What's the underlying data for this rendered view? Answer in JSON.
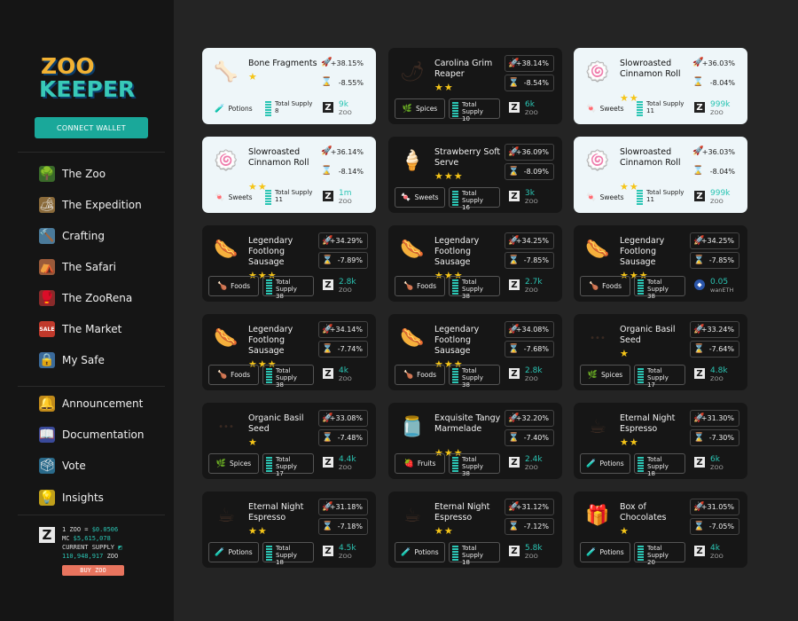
{
  "logo": {
    "line1": "ZOO",
    "line2": "KEEPER"
  },
  "connect_label": "CONNECT WALLET",
  "nav": [
    {
      "label": "The Zoo",
      "icon": "zoo-icon",
      "emoji": "🌳",
      "bg": "#3a6a2a"
    },
    {
      "label": "The Expedition",
      "icon": "expedition-icon",
      "emoji": "🏕",
      "bg": "#8a6a3a"
    },
    {
      "label": "Crafting",
      "icon": "crafting-icon",
      "emoji": "🔨",
      "bg": "#4a7a9a"
    },
    {
      "label": "The Safari",
      "icon": "safari-icon",
      "emoji": "⛺",
      "bg": "#9a5a3a"
    },
    {
      "label": "The ZooRena",
      "icon": "zoorena-icon",
      "emoji": "🥊",
      "bg": "#8a2a2a"
    },
    {
      "label": "The Market",
      "icon": "market-icon",
      "emoji": "SALE",
      "bg": "#c0392b"
    },
    {
      "label": "My Safe",
      "icon": "safe-icon",
      "emoji": "🔒",
      "bg": "#3a6a9a"
    },
    {
      "label": "Announcement",
      "icon": "bell-icon",
      "emoji": "🔔",
      "bg": "#c08a1a"
    },
    {
      "label": "Documentation",
      "icon": "book-icon",
      "emoji": "📖",
      "bg": "#3a4a9a"
    },
    {
      "label": "Vote",
      "icon": "vote-icon",
      "emoji": "🗳",
      "bg": "#2a6a8a"
    },
    {
      "label": "Insights",
      "icon": "insights-icon",
      "emoji": "💡",
      "bg": "#c0a01a"
    }
  ],
  "zinfo": {
    "l1a": "1 ZOO = ",
    "l1b": "$0.0506",
    "l2a": "MC ",
    "l2b": "$5,615,078",
    "l3": "CURRENT SUPPLY",
    "l4a": "110,948,917",
    "l4b": " ZOO",
    "buy": "BUY ZOO"
  },
  "cards": [
    {
      "name": "Bone Fragments",
      "stars": "★",
      "up": "+38.15%",
      "down": "-8.55%",
      "cat": "Potions",
      "catIcon": "potion-icon",
      "catGlyph": "🧪",
      "supply_label": "Total Supply",
      "supply": "8",
      "price": "9k",
      "unit": "ZOO",
      "img": "bone-icon",
      "glyph": "🦴",
      "light": true
    },
    {
      "name": "Carolina Grim Reaper",
      "stars": "★★",
      "up": "+38.14%",
      "down": "-8.54%",
      "cat": "Spices",
      "catIcon": "spice-icon",
      "catGlyph": "🌿",
      "supply_label": "Total Supply",
      "supply": "10",
      "price": "6k",
      "unit": "ZOO",
      "img": "pepper-icon",
      "glyph": "🌶",
      "light": false
    },
    {
      "name": "Slowroasted Cinnamon Roll",
      "stars": "★★",
      "up": "+36.03%",
      "down": "-8.04%",
      "cat": "Sweets",
      "catIcon": "candy-icon",
      "catGlyph": "🍬",
      "supply_label": "Total Supply",
      "supply": "11",
      "price": "999k",
      "unit": "ZOO",
      "img": "cinnamon-roll-icon",
      "glyph": "🍥",
      "light": true
    },
    {
      "name": "Slowroasted Cinnamon Roll",
      "stars": "★★",
      "up": "+36.14%",
      "down": "-8.14%",
      "cat": "Sweets",
      "catIcon": "candy-icon",
      "catGlyph": "🍬",
      "supply_label": "Total Supply",
      "supply": "11",
      "price": "1m",
      "unit": "ZOO",
      "img": "cinnamon-roll-icon",
      "glyph": "🍥",
      "light": true
    },
    {
      "name": "Strawberry Soft Serve",
      "stars": "★★★",
      "up": "+36.09%",
      "down": "-8.09%",
      "cat": "Sweets",
      "catIcon": "candy-icon",
      "catGlyph": "🍬",
      "supply_label": "Total Supply",
      "supply": "16",
      "price": "3k",
      "unit": "ZOO",
      "img": "ice-cream-icon",
      "glyph": "🍦",
      "light": false
    },
    {
      "name": "Slowroasted Cinnamon Roll",
      "stars": "★★",
      "up": "+36.03%",
      "down": "-8.04%",
      "cat": "Sweets",
      "catIcon": "candy-icon",
      "catGlyph": "🍬",
      "supply_label": "Total Supply",
      "supply": "11",
      "price": "999k",
      "unit": "ZOO",
      "img": "cinnamon-roll-icon",
      "glyph": "🍥",
      "light": true
    },
    {
      "name": "Legendary Footlong Sausage",
      "stars": "★★★",
      "up": "+34.29%",
      "down": "-7.89%",
      "cat": "Foods",
      "catIcon": "food-icon",
      "catGlyph": "🍗",
      "supply_label": "Total Supply",
      "supply": "38",
      "price": "2.8k",
      "unit": "ZOO",
      "img": "sausage-icon",
      "glyph": "🌭",
      "light": false
    },
    {
      "name": "Legendary Footlong Sausage",
      "stars": "★★★",
      "up": "+34.25%",
      "down": "-7.85%",
      "cat": "Foods",
      "catIcon": "food-icon",
      "catGlyph": "🍗",
      "supply_label": "Total Supply",
      "supply": "38",
      "price": "2.7k",
      "unit": "ZOO",
      "img": "sausage-icon",
      "glyph": "🌭",
      "light": false
    },
    {
      "name": "Legendary Footlong Sausage",
      "stars": "★★★",
      "up": "+34.25%",
      "down": "-7.85%",
      "cat": "Foods",
      "catIcon": "food-icon",
      "catGlyph": "🍗",
      "supply_label": "Total Supply",
      "supply": "38",
      "price": "0.05",
      "unit": "wanETH",
      "img": "sausage-icon",
      "glyph": "🌭",
      "light": false,
      "eth": true
    },
    {
      "name": "Legendary Footlong Sausage",
      "stars": "★★★",
      "up": "+34.14%",
      "down": "-7.74%",
      "cat": "Foods",
      "catIcon": "food-icon",
      "catGlyph": "🍗",
      "supply_label": "Total Supply",
      "supply": "38",
      "price": "4k",
      "unit": "ZOO",
      "img": "sausage-icon",
      "glyph": "🌭",
      "light": false
    },
    {
      "name": "Legendary Footlong Sausage",
      "stars": "★★★",
      "up": "+34.08%",
      "down": "-7.68%",
      "cat": "Foods",
      "catIcon": "food-icon",
      "catGlyph": "🍗",
      "supply_label": "Total Supply",
      "supply": "38",
      "price": "2.8k",
      "unit": "ZOO",
      "img": "sausage-icon",
      "glyph": "🌭",
      "light": false
    },
    {
      "name": "Organic Basil Seed",
      "stars": "★",
      "up": "+33.24%",
      "down": "-7.64%",
      "cat": "Spices",
      "catIcon": "spice-icon",
      "catGlyph": "🌿",
      "supply_label": "Total Supply",
      "supply": "17",
      "price": "4.8k",
      "unit": "ZOO",
      "img": "seed-icon",
      "glyph": "•••",
      "light": false
    },
    {
      "name": "Organic Basil Seed",
      "stars": "★",
      "up": "+33.08%",
      "down": "-7.48%",
      "cat": "Spices",
      "catIcon": "spice-icon",
      "catGlyph": "🌿",
      "supply_label": "Total Supply",
      "supply": "17",
      "price": "4.4k",
      "unit": "ZOO",
      "img": "seed-icon",
      "glyph": "•••",
      "light": false
    },
    {
      "name": "Exquisite Tangy Marmelade",
      "stars": "★★★",
      "up": "+32.20%",
      "down": "-7.40%",
      "cat": "Fruits",
      "catIcon": "fruit-icon",
      "catGlyph": "🍓",
      "supply_label": "Total Supply",
      "supply": "38",
      "price": "2.4k",
      "unit": "ZOO",
      "img": "jar-icon",
      "glyph": "🫙",
      "light": false
    },
    {
      "name": "Eternal Night Espresso",
      "stars": "★★",
      "up": "+31.30%",
      "down": "-7.30%",
      "cat": "Potions",
      "catIcon": "potion-icon",
      "catGlyph": "🧪",
      "supply_label": "Total Supply",
      "supply": "18",
      "price": "6k",
      "unit": "ZOO",
      "img": "coffee-icon",
      "glyph": "☕",
      "light": false
    },
    {
      "name": "Eternal Night Espresso",
      "stars": "★★",
      "up": "+31.18%",
      "down": "-7.18%",
      "cat": "Potions",
      "catIcon": "potion-icon",
      "catGlyph": "🧪",
      "supply_label": "Total Supply",
      "supply": "18",
      "price": "4.5k",
      "unit": "ZOO",
      "img": "coffee-icon",
      "glyph": "☕",
      "light": false
    },
    {
      "name": "Eternal Night Espresso",
      "stars": "★★",
      "up": "+31.12%",
      "down": "-7.12%",
      "cat": "Potions",
      "catIcon": "potion-icon",
      "catGlyph": "🧪",
      "supply_label": "Total Supply",
      "supply": "18",
      "price": "5.8k",
      "unit": "ZOO",
      "img": "coffee-icon",
      "glyph": "☕",
      "light": false
    },
    {
      "name": "Box of Chocolates",
      "stars": "★",
      "up": "+31.05%",
      "down": "-7.05%",
      "cat": "Potions",
      "catIcon": "potion-icon",
      "catGlyph": "🧪",
      "supply_label": "Total Supply",
      "supply": "20",
      "price": "4k",
      "unit": "ZOO",
      "img": "chocolate-box-icon",
      "glyph": "🎁",
      "light": false
    }
  ]
}
